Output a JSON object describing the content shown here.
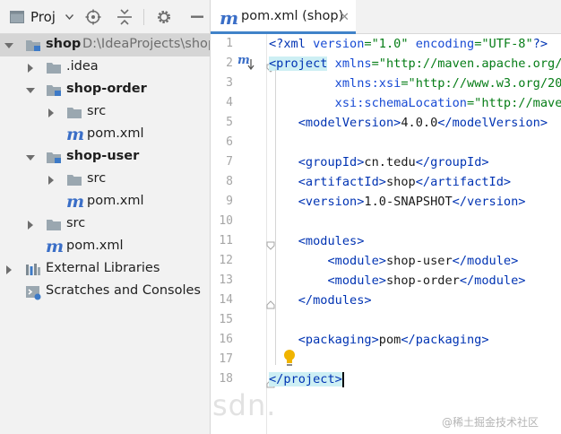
{
  "project_panel": {
    "view_label": "Proj",
    "tree": [
      {
        "name": "shop",
        "hint": "D:\\IdeaProjects\\shop"
      },
      {
        "name": ".idea"
      },
      {
        "name": "shop-order"
      },
      {
        "name": "src"
      },
      {
        "name": "pom.xml"
      },
      {
        "name": "shop-user"
      },
      {
        "name": "src"
      },
      {
        "name": "pom.xml"
      },
      {
        "name": "src"
      },
      {
        "name": "pom.xml"
      },
      {
        "name": "External Libraries"
      },
      {
        "name": "Scratches and Consoles"
      }
    ]
  },
  "editor": {
    "tab": {
      "label": "pom.xml (shop)",
      "icon": "m",
      "close": "✕"
    },
    "line_numbers": [
      "1",
      "2",
      "3",
      "4",
      "5",
      "6",
      "7",
      "8",
      "9",
      "10",
      "11",
      "12",
      "13",
      "14",
      "15",
      "16",
      "17",
      "18"
    ],
    "gutter_marker": "m"
  },
  "watermark": {
    "left": "sdn.",
    "right": "@稀土掘金技术社区"
  },
  "colors": {
    "tag": "#0033b3",
    "attribute": "#174ad4",
    "value": "#067d17",
    "tab_underline": "#4083c9",
    "selection": "#d5d5d5"
  }
}
